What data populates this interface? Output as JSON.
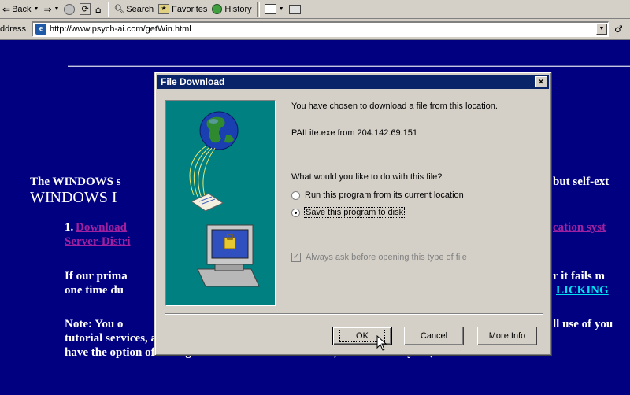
{
  "toolbar": {
    "back_label": "Back",
    "search_label": "Search",
    "favorites_label": "Favorites",
    "history_label": "History"
  },
  "address": {
    "label": "ddress",
    "url": "http://www.psych-ai.com/getWin.html"
  },
  "page": {
    "heading_line1_a": "The WINDOWS s",
    "heading_line1_b": "but self-ext",
    "heading_line2": "WINDOWS I",
    "item1_number": "1.",
    "item1_link_a": "Download",
    "item1_link_b": "cation syst",
    "item1_link_line2": "Server-Distri",
    "para1_line1_a": "If our prima",
    "para1_line1_b": "r it fails m",
    "para1_line2_a": "one time du",
    "para1_line2_link": "LICKING",
    "note_line1_a": "Note: You o",
    "note_line1_b": "ll use of you",
    "note_line2": "tutorial services, and on-line certification testing. During use of this system, you",
    "note_line3": "have the option of setting its \"cache\" services to \"on\", which allows you (or not"
  },
  "dialog": {
    "title": "File Download",
    "intro": "You have chosen to download a file from this location.",
    "file_info": "PAILite.exe from 204.142.69.151",
    "question": "What would you like to do with this file?",
    "option_run": "Run this program from its current location",
    "option_save": "Save this program to disk",
    "selected_option": "save",
    "always_ask": "Always ask before opening this type of file",
    "always_ask_checked": true,
    "ok_label": "OK",
    "cancel_label": "Cancel",
    "more_info_label": "More Info"
  },
  "colors": {
    "page_bg": "#000080",
    "titlebar": "#0a246a",
    "link_purple": "#a020a0",
    "link_cyan": "#00e0f0",
    "dialog_art_bg": "#008080"
  }
}
